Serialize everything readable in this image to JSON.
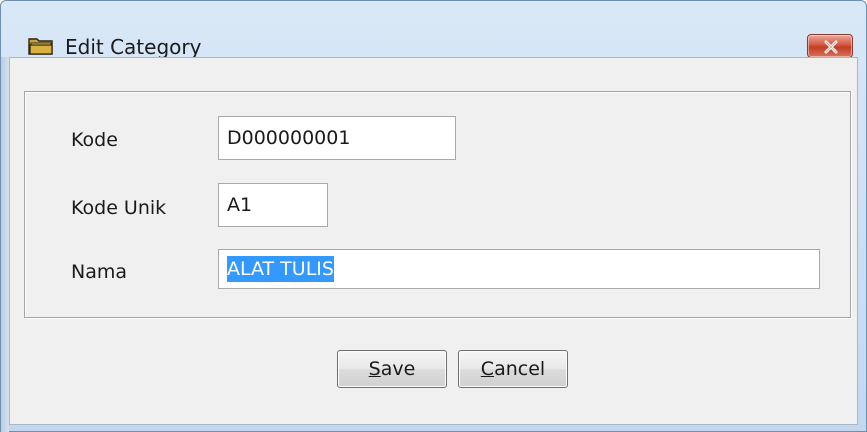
{
  "window": {
    "title": "Edit Category",
    "title_icon": "folder-icon",
    "close_icon": "close-icon"
  },
  "form": {
    "kode": {
      "label": "Kode",
      "value": "D000000001"
    },
    "kode_unik": {
      "label": "Kode Unik",
      "value": "A1"
    },
    "nama": {
      "label": "Nama",
      "value": "ALAT TULIS",
      "selected": true
    }
  },
  "buttons": {
    "save": {
      "mnemonic": "S",
      "rest": "ave"
    },
    "cancel": {
      "mnemonic": "C",
      "rest": "ancel"
    }
  },
  "colors": {
    "selection": "#3399ff",
    "close_button": "#c23d25",
    "frame": "#c3d8ef"
  }
}
